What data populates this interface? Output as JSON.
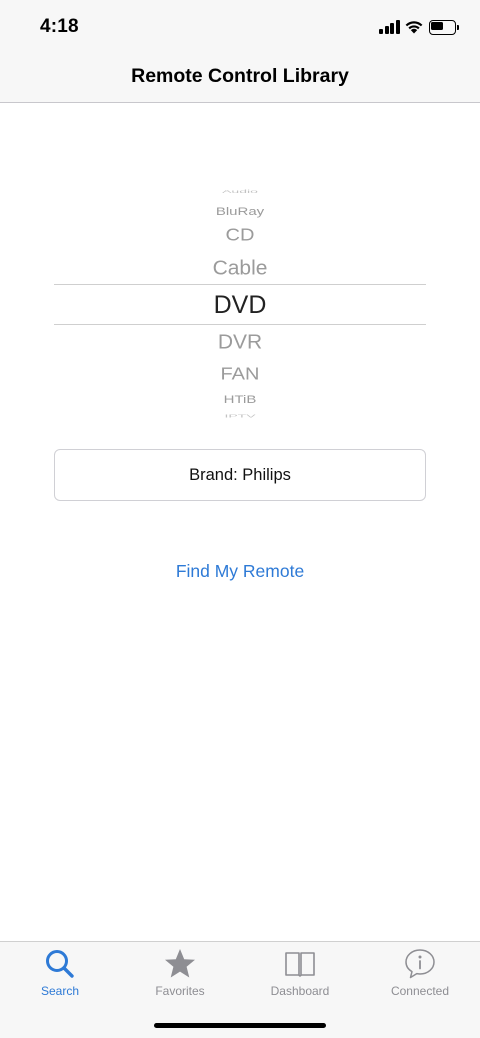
{
  "status_bar": {
    "time": "4:18",
    "battery_level": 0.5,
    "signal_icon": "cellular-signal-icon",
    "wifi_icon": "wifi-icon",
    "battery_icon": "battery-icon"
  },
  "nav": {
    "title": "Remote Control Library"
  },
  "device_picker": {
    "items": [
      "Audio",
      "BluRay",
      "CD",
      "Cable",
      "DVD",
      "DVR",
      "FAN",
      "HTiB",
      "IPTV"
    ],
    "selected": "DVD",
    "selected_color": "#222222",
    "dimmed_color": "#9b9b9b"
  },
  "brand": {
    "label": "Brand: Philips"
  },
  "find_button": {
    "label": "Find My Remote"
  },
  "tab_bar": {
    "active_color": "#2e7ad6",
    "inactive_color": "#8e8e93",
    "tabs": [
      {
        "label": "Search",
        "icon": "search-icon",
        "active": true
      },
      {
        "label": "Favorites",
        "icon": "star-icon",
        "active": false
      },
      {
        "label": "Dashboard",
        "icon": "book-icon",
        "active": false
      },
      {
        "label": "Connected",
        "icon": "info-bubble-icon",
        "active": false
      }
    ]
  }
}
